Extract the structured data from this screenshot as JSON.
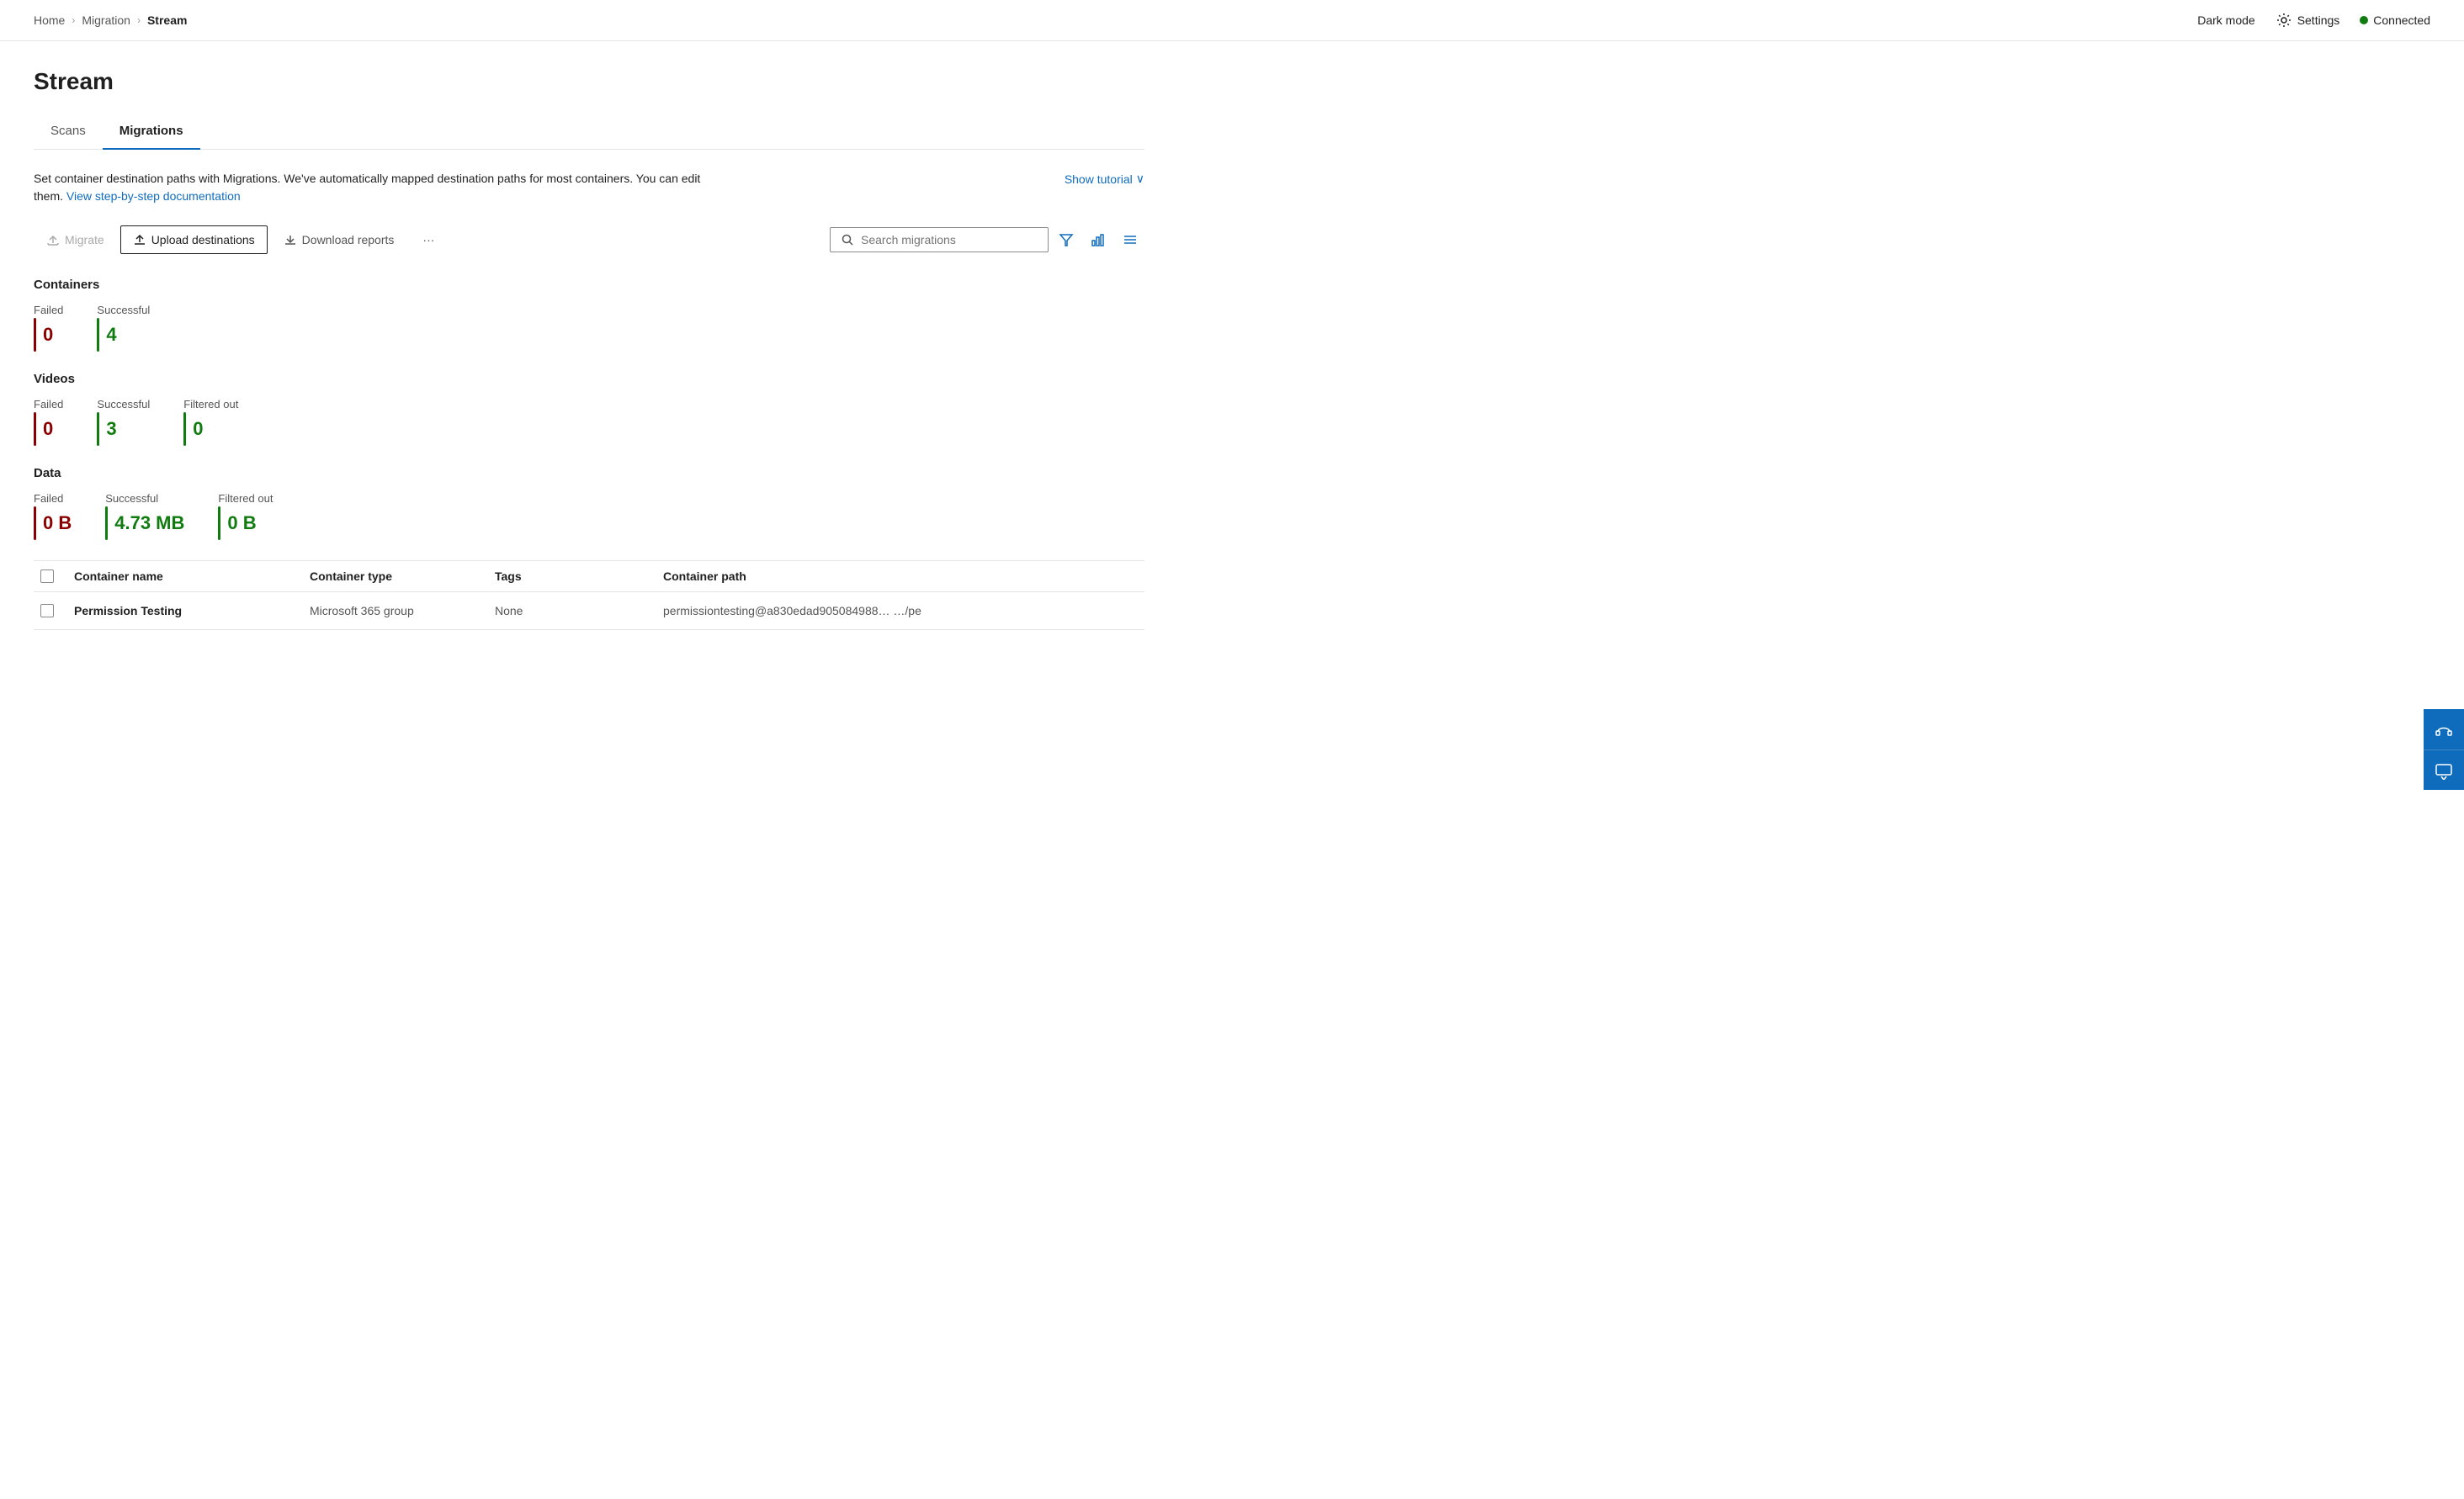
{
  "breadcrumb": {
    "home": "Home",
    "migration": "Migration",
    "current": "Stream",
    "sep1": "›",
    "sep2": "›"
  },
  "topbar": {
    "dark_mode_label": "Dark mode",
    "settings_label": "Settings",
    "connected_label": "Connected"
  },
  "page": {
    "title": "Stream"
  },
  "tabs": [
    {
      "id": "scans",
      "label": "Scans",
      "active": false
    },
    {
      "id": "migrations",
      "label": "Migrations",
      "active": true
    }
  ],
  "description": {
    "text1": "Set container destination paths with Migrations. We've automatically mapped destination paths for most containers. You can edit them.",
    "link_text": "View step-by-step documentation",
    "show_tutorial": "Show tutorial"
  },
  "toolbar": {
    "migrate_label": "Migrate",
    "upload_label": "Upload destinations",
    "download_label": "Download reports",
    "more_label": "···",
    "search_placeholder": "Search migrations"
  },
  "stats": {
    "containers": {
      "title": "Containers",
      "failed": {
        "label": "Failed",
        "value": "0"
      },
      "successful": {
        "label": "Successful",
        "value": "4"
      }
    },
    "videos": {
      "title": "Videos",
      "failed": {
        "label": "Failed",
        "value": "0"
      },
      "successful": {
        "label": "Successful",
        "value": "3"
      },
      "filtered_out": {
        "label": "Filtered out",
        "value": "0"
      }
    },
    "data": {
      "title": "Data",
      "failed": {
        "label": "Failed",
        "value": "0 B"
      },
      "successful": {
        "label": "Successful",
        "value": "4.73 MB"
      },
      "filtered_out": {
        "label": "Filtered out",
        "value": "0 B"
      }
    }
  },
  "table": {
    "headers": [
      "",
      "Container name",
      "Container type",
      "Tags",
      "Container path"
    ],
    "rows": [
      {
        "name": "Permission Testing",
        "type": "Microsoft 365 group",
        "tags": "None",
        "path": "permissiontesting@a830edad905084988…  …/pe"
      }
    ]
  }
}
